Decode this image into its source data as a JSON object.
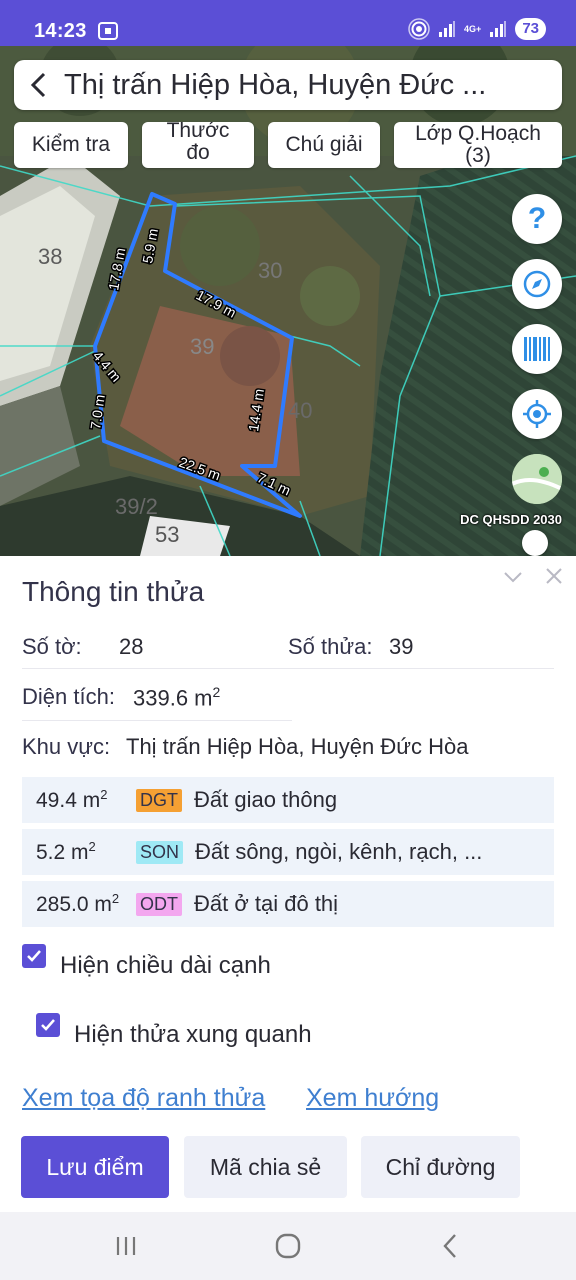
{
  "status_bar": {
    "time": "14:23",
    "network": "4G+",
    "battery": "73"
  },
  "map": {
    "title": "Thị trấn Hiệp Hòa, Huyện Đức ...",
    "chips": [
      "Kiểm tra",
      "Thước đo",
      "Chú giải",
      "Lớp Q.Hoạch (3)"
    ],
    "parcel_numbers": [
      "38",
      "39",
      "40",
      "30",
      "39/2",
      "53"
    ],
    "edge_labels": [
      "17.8 m",
      "5.9 m",
      "17.9 m",
      "4.4 m",
      "7.0 m",
      "14.4 m",
      "22.5 m",
      "7.1 m"
    ],
    "caption": "DC QHSDD 2030",
    "icons": [
      "help-icon",
      "compass-icon",
      "barcode-icon",
      "locate-icon",
      "map-thumbnail"
    ]
  },
  "panel": {
    "title": "Thông tin thửa",
    "sheet_label": "Số tờ:",
    "sheet_value": "28",
    "parcel_label": "Số thửa:",
    "parcel_value": "39",
    "area_label": "Diện tích:",
    "area_value": "339.6 m",
    "area_unit_sup": "2",
    "region_label": "Khu vực:",
    "region_value": "Thị trấn Hiệp Hòa, Huyện Đức Hòa",
    "land_uses": [
      {
        "area": "49.4 m",
        "sup": "2",
        "code": "DGT",
        "code_color": "#f5a033",
        "name": "Đất giao thông"
      },
      {
        "area": "5.2 m",
        "sup": "2",
        "code": "SON",
        "code_color": "#9fe9f5",
        "name": "Đất sông, ngòi, kênh, rạch, ..."
      },
      {
        "area": "285.0 m",
        "sup": "2",
        "code": "ODT",
        "code_color": "#f3a7ef",
        "name": "Đất ở tại đô thị"
      }
    ],
    "checkboxes": [
      {
        "label": "Hiện chiều dài cạnh",
        "checked": true
      },
      {
        "label": "Hiện thửa xung quanh",
        "checked": true
      }
    ],
    "links": [
      "Xem tọa độ ranh thửa",
      "Xem hướng"
    ],
    "buttons": {
      "save": "Lưu điểm",
      "share": "Mã chia sẻ",
      "directions": "Chỉ đường"
    }
  },
  "colors": {
    "accent": "#5b4fd6",
    "link": "#3f7fd0",
    "parcel_outline": "#2f7bff",
    "cadastral_lines": "#3fd9c8"
  }
}
